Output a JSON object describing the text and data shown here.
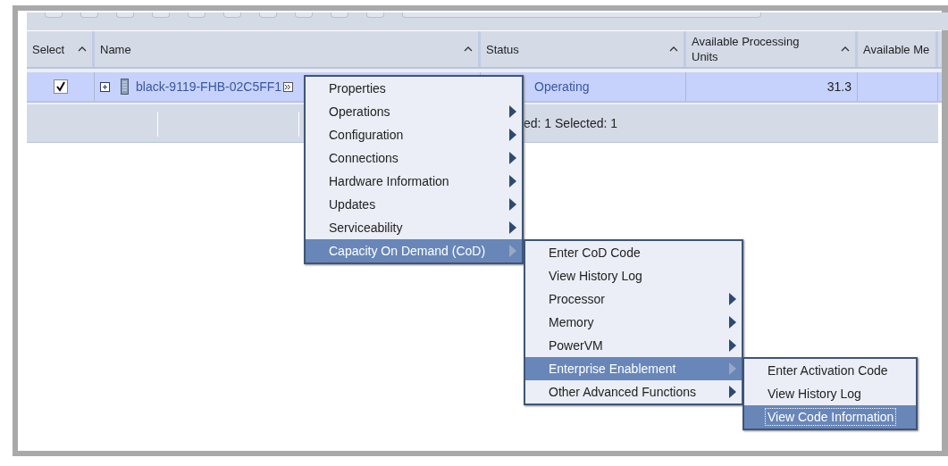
{
  "table": {
    "columns": [
      {
        "label": "Select",
        "sortable": true
      },
      {
        "label": "Name",
        "sortable": true
      },
      {
        "label": "Status",
        "sortable": true
      },
      {
        "label": "Available Processing Units",
        "sortable": true
      },
      {
        "label": "Available Me",
        "sortable": false
      }
    ],
    "rows": [
      {
        "selected": true,
        "checked": true,
        "name": "black-9119-FHB-02C5FF1",
        "status": "Operating",
        "processing_units": "31.3"
      }
    ],
    "footer": "ed: 1   Selected: 1"
  },
  "menus": [
    {
      "items": [
        {
          "label": "Properties",
          "submenu": false,
          "selected": false,
          "focused": false
        },
        {
          "label": "Operations",
          "submenu": true,
          "selected": false,
          "focused": false
        },
        {
          "label": "Configuration",
          "submenu": true,
          "selected": false,
          "focused": false
        },
        {
          "label": "Connections",
          "submenu": true,
          "selected": false,
          "focused": false
        },
        {
          "label": "Hardware Information",
          "submenu": true,
          "selected": false,
          "focused": false
        },
        {
          "label": "Updates",
          "submenu": true,
          "selected": false,
          "focused": false
        },
        {
          "label": "Serviceability",
          "submenu": true,
          "selected": false,
          "focused": false
        },
        {
          "label": "Capacity On Demand (CoD)",
          "submenu": true,
          "selected": true,
          "focused": false
        }
      ]
    },
    {
      "items": [
        {
          "label": "Enter CoD Code",
          "submenu": false,
          "selected": false,
          "focused": false
        },
        {
          "label": "View History Log",
          "submenu": false,
          "selected": false,
          "focused": false
        },
        {
          "label": "Processor",
          "submenu": true,
          "selected": false,
          "focused": false
        },
        {
          "label": "Memory",
          "submenu": true,
          "selected": false,
          "focused": false
        },
        {
          "label": "PowerVM",
          "submenu": true,
          "selected": false,
          "focused": false
        },
        {
          "label": "Enterprise Enablement",
          "submenu": true,
          "selected": true,
          "focused": false
        },
        {
          "label": "Other Advanced Functions",
          "submenu": true,
          "selected": false,
          "focused": false
        }
      ]
    },
    {
      "items": [
        {
          "label": "Enter Activation Code",
          "submenu": false,
          "selected": false,
          "focused": false
        },
        {
          "label": "View History Log",
          "submenu": false,
          "selected": false,
          "focused": false
        },
        {
          "label": "View Code Information",
          "submenu": false,
          "selected": true,
          "focused": true
        }
      ]
    }
  ]
}
